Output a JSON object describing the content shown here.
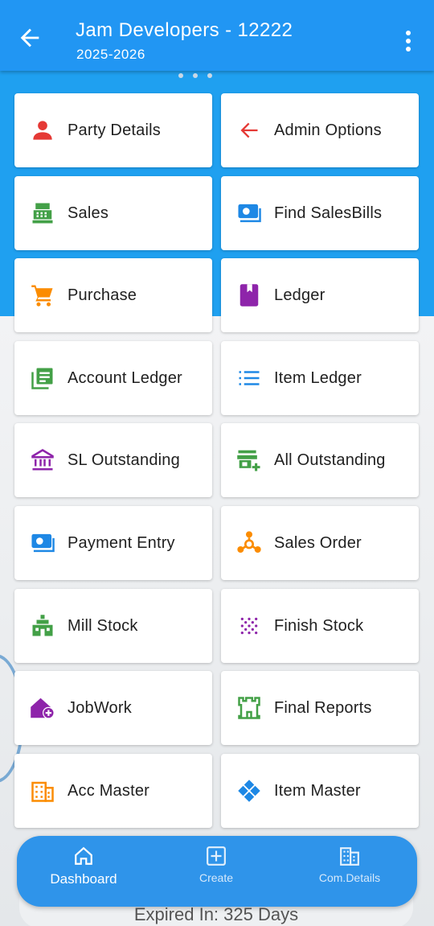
{
  "app": {
    "title": "Jam Developers - 12222",
    "subtitle": "2025-2026"
  },
  "colors": {
    "appbar": "#2196f3",
    "accent_blue": "#1fa0f0",
    "nav_bg": "#2f94ea"
  },
  "menu": [
    {
      "label": "Party Details",
      "icon": "person-icon",
      "color": "#e53935"
    },
    {
      "label": "Admin Options",
      "icon": "arrow-left-icon",
      "color": "#e53935"
    },
    {
      "label": "Sales",
      "icon": "cash-register-icon",
      "color": "#43a047"
    },
    {
      "label": "Find SalesBills",
      "icon": "money-bill-icon",
      "color": "#1e88e5"
    },
    {
      "label": "Purchase",
      "icon": "cart-icon",
      "color": "#fb8c00"
    },
    {
      "label": "Ledger",
      "icon": "book-icon",
      "color": "#8e24aa"
    },
    {
      "label": "Account Ledger",
      "icon": "document-list-icon",
      "color": "#43a047"
    },
    {
      "label": "Item Ledger",
      "icon": "list-icon",
      "color": "#1e88e5"
    },
    {
      "label": "SL Outstanding",
      "icon": "bank-icon",
      "color": "#8e24aa"
    },
    {
      "label": "All Outstanding",
      "icon": "store-add-icon",
      "color": "#43a047"
    },
    {
      "label": "Payment Entry",
      "icon": "payment-icon",
      "color": "#1e88e5"
    },
    {
      "label": "Sales Order",
      "icon": "hub-icon",
      "color": "#fb8c00"
    },
    {
      "label": "Mill Stock",
      "icon": "factory-icon",
      "color": "#43a047"
    },
    {
      "label": "Finish Stock",
      "icon": "dots-grid-icon",
      "color": "#8e24aa"
    },
    {
      "label": "JobWork",
      "icon": "home-add-icon",
      "color": "#8e24aa"
    },
    {
      "label": "Final Reports",
      "icon": "castle-icon",
      "color": "#43a047"
    },
    {
      "label": "Acc Master",
      "icon": "building-icon",
      "color": "#fb8c00"
    },
    {
      "label": "Item Master",
      "icon": "diamond-grid-icon",
      "color": "#1e88e5"
    }
  ],
  "bottom_nav": {
    "dashboard": "Dashboard",
    "create": "Create",
    "com_details": "Com.Details"
  },
  "footer": {
    "expired": "Expired In: 325 Days"
  }
}
